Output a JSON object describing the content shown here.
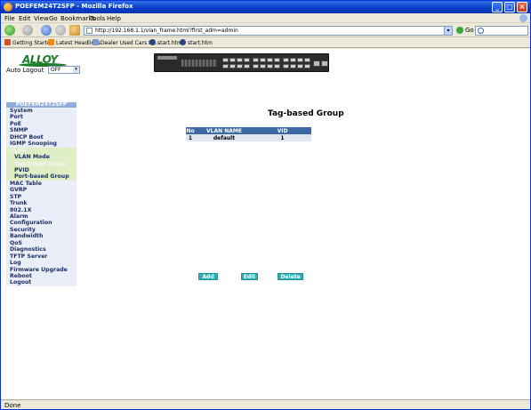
{
  "window": {
    "title": "POEFEM24T2SFP - Mozilla Firefox"
  },
  "menu": [
    "File",
    "Edit",
    "View",
    "Go",
    "Bookmarks",
    "Tools",
    "Help"
  ],
  "navigation": {
    "url": "http://192.168.1.1/vlan_frame.html?first_adm=admin",
    "go_label": "Go",
    "search_placeholder": ""
  },
  "bookmarks": [
    {
      "label": "Getting Started",
      "icon": "firefox-icon"
    },
    {
      "label": "Latest Headlines",
      "icon": "rss-icon"
    },
    {
      "label": "Dealer Used Cars En...",
      "icon": "page-icon"
    },
    {
      "label": "start.htm",
      "icon": "globe-icon"
    },
    {
      "label": "start.htm",
      "icon": "globe-icon"
    }
  ],
  "header": {
    "logo_text": "ALLOY",
    "auto_logout_label": "Auto Logout",
    "auto_logout_value": "OFF"
  },
  "sidebar": {
    "title": "POEFEM24T2SFP",
    "items": [
      {
        "label": "System",
        "type": "item"
      },
      {
        "label": "Port",
        "type": "item"
      },
      {
        "label": "PoE",
        "type": "item"
      },
      {
        "label": "SNMP",
        "type": "item"
      },
      {
        "label": "DHCP Boot",
        "type": "item"
      },
      {
        "label": "IGMP Snooping",
        "type": "item"
      },
      {
        "label": "VLAN",
        "type": "vlan"
      },
      {
        "label": "VLAN Mode",
        "type": "sub"
      },
      {
        "label": "Tag-based Group",
        "type": "sub-active"
      },
      {
        "label": "PVID",
        "type": "sub"
      },
      {
        "label": "Port-based Group",
        "type": "sub"
      },
      {
        "label": "MAC Table",
        "type": "item"
      },
      {
        "label": "GVRP",
        "type": "item"
      },
      {
        "label": "STP",
        "type": "item"
      },
      {
        "label": "Trunk",
        "type": "item"
      },
      {
        "label": "802.1X",
        "type": "item"
      },
      {
        "label": "Alarm",
        "type": "item"
      },
      {
        "label": "Configuration",
        "type": "item"
      },
      {
        "label": "Security",
        "type": "item"
      },
      {
        "label": "Bandwidth",
        "type": "item"
      },
      {
        "label": "QoS",
        "type": "item"
      },
      {
        "label": "Diagnostics",
        "type": "item"
      },
      {
        "label": "TFTP Server",
        "type": "item"
      },
      {
        "label": "Log",
        "type": "item"
      },
      {
        "label": "Firmware Upgrade",
        "type": "item"
      },
      {
        "label": "Reboot",
        "type": "item"
      },
      {
        "label": "Logout",
        "type": "item"
      }
    ]
  },
  "main": {
    "title": "Tag-based Group",
    "table": {
      "headers": [
        "No",
        "VLAN NAME",
        "VID"
      ],
      "rows": [
        [
          "1",
          "default",
          "1"
        ]
      ]
    },
    "buttons": {
      "add": "Add",
      "edit": "Edit",
      "delete": "Delete"
    }
  },
  "status": {
    "text": "Done"
  },
  "colors": {
    "table_header": "#3d6aa3",
    "button": "#30b0b5",
    "sidebar_bg": "#e9eef8",
    "sidebar_vlan_bg": "#dfeec5",
    "logo": "#1b7c2a"
  }
}
